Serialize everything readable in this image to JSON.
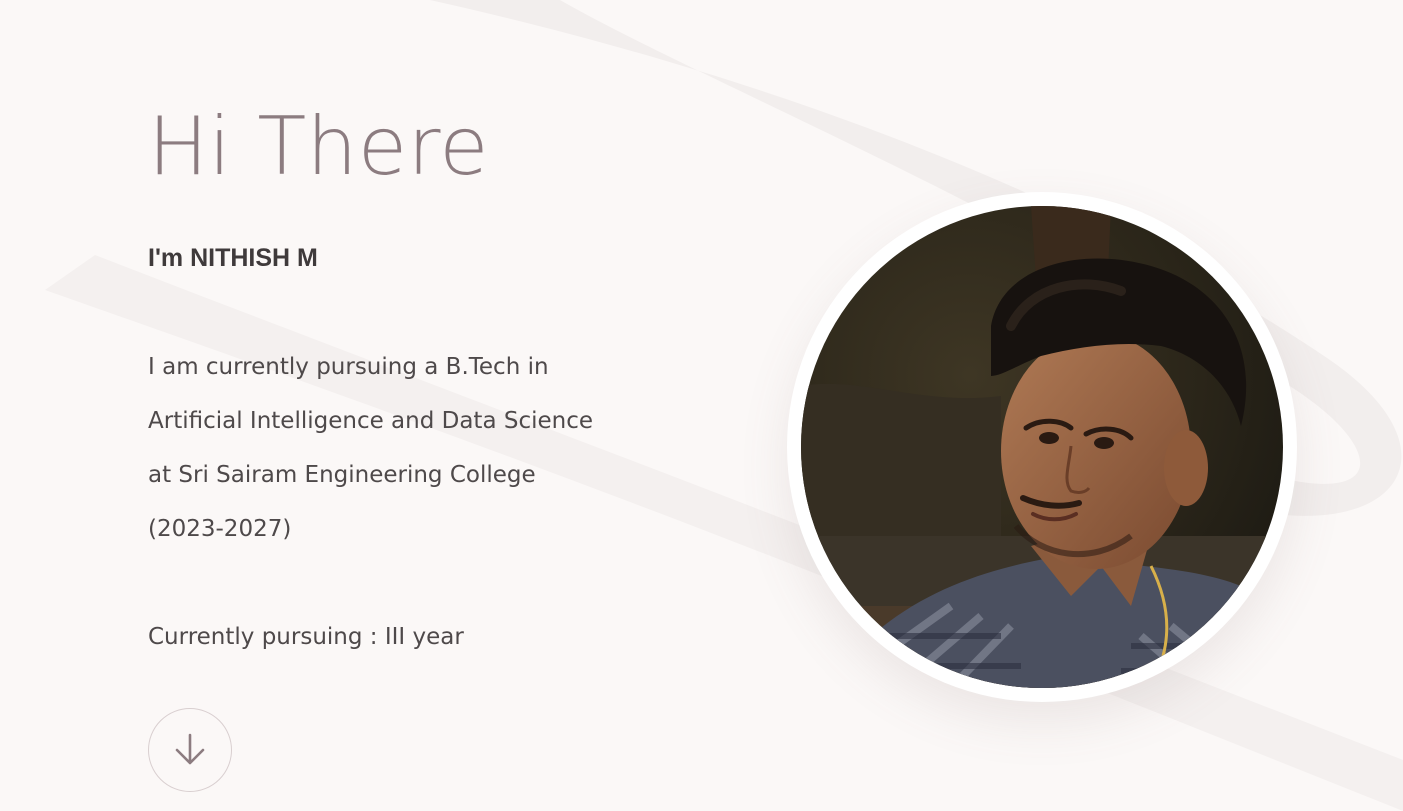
{
  "hero": {
    "greeting": "Hi There",
    "name": "I'm NITHISH M",
    "bio_lines": [
      "I am currently pursuing a B.Tech in",
      "Artificial Intelligence and Data Science",
      "at Sri Sairam Engineering College",
      "(2023-2027)"
    ],
    "status": "Currently pursuing : III year"
  },
  "scroll_button": {
    "icon": "arrow-down-icon"
  },
  "profile_photo": {
    "icon": "profile-photo"
  },
  "colors": {
    "background": "#fbf8f7",
    "heading": "#8c7c80",
    "text": "#4e494a",
    "name": "#3f3a3b"
  }
}
